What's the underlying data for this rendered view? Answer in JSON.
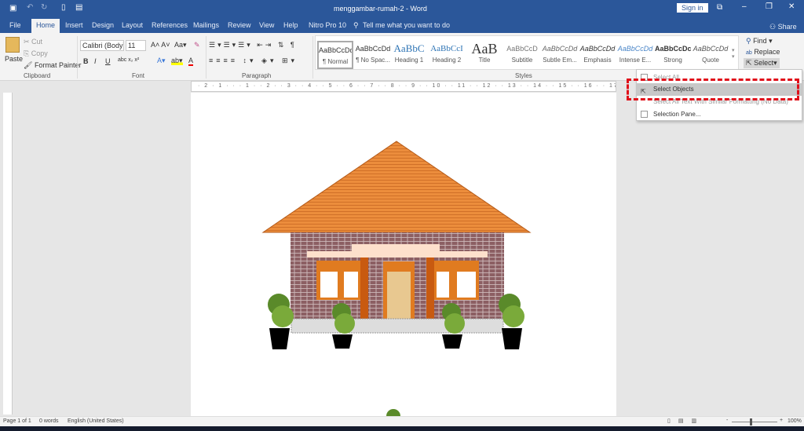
{
  "window": {
    "title": "menggambar-rumah-2  -  Word",
    "sign_in": "Sign in",
    "share": "Share"
  },
  "tabs": [
    "File",
    "Home",
    "Insert",
    "Design",
    "Layout",
    "References",
    "Mailings",
    "Review",
    "View",
    "Help",
    "Nitro Pro 10"
  ],
  "tell_me": "Tell me what you want to do",
  "clipboard": {
    "paste": "Paste",
    "cut": "Cut",
    "copy": "Copy",
    "format_painter": "Format Painter",
    "label": "Clipboard"
  },
  "font": {
    "name": "Calibri (Body)",
    "size": "11",
    "label": "Font",
    "bold": "B",
    "italic": "I",
    "underline": "U"
  },
  "paragraph": {
    "label": "Paragraph"
  },
  "styles": {
    "label": "Styles",
    "items": [
      {
        "sample": "AaBbCcDd",
        "name": "¶ Normal"
      },
      {
        "sample": "AaBbCcDd",
        "name": "¶ No Spac..."
      },
      {
        "sample": "AaBbC",
        "name": "Heading 1"
      },
      {
        "sample": "AaBbCcI",
        "name": "Heading 2"
      },
      {
        "sample": "AaB",
        "name": "Title"
      },
      {
        "sample": "AaBbCcD",
        "name": "Subtitle"
      },
      {
        "sample": "AaBbCcDd",
        "name": "Subtle Em..."
      },
      {
        "sample": "AaBbCcDd",
        "name": "Emphasis"
      },
      {
        "sample": "AaBbCcDd",
        "name": "Intense E..."
      },
      {
        "sample": "AaBbCcDc",
        "name": "Strong"
      },
      {
        "sample": "AaBbCcDd",
        "name": "Quote"
      }
    ]
  },
  "editing": {
    "find": "Find",
    "replace": "Replace",
    "select": "Select"
  },
  "ruler": "· 2 · 1 · · · 1 · · 2 · · 3 · · 4 · · 5 · · 6 · · 7 · · 8 · · 9 · · 10 · · 11 · · 12 · · 13 · · 14 · · 15 · · 16 · · 17 · · 18 · · 19",
  "select_menu": [
    "Select All",
    "Select Objects",
    "Select All Text With Similar Formatting (No Data)",
    "Selection Pane..."
  ],
  "status": {
    "page": "Page 1 of 1",
    "words": "0 words",
    "language": "English (United States)",
    "zoom": "100%"
  },
  "colors": {
    "brand": "#2b579a",
    "highlight": "#e0101a",
    "roof": "#e8883a",
    "wall": "#8a5a5a"
  }
}
